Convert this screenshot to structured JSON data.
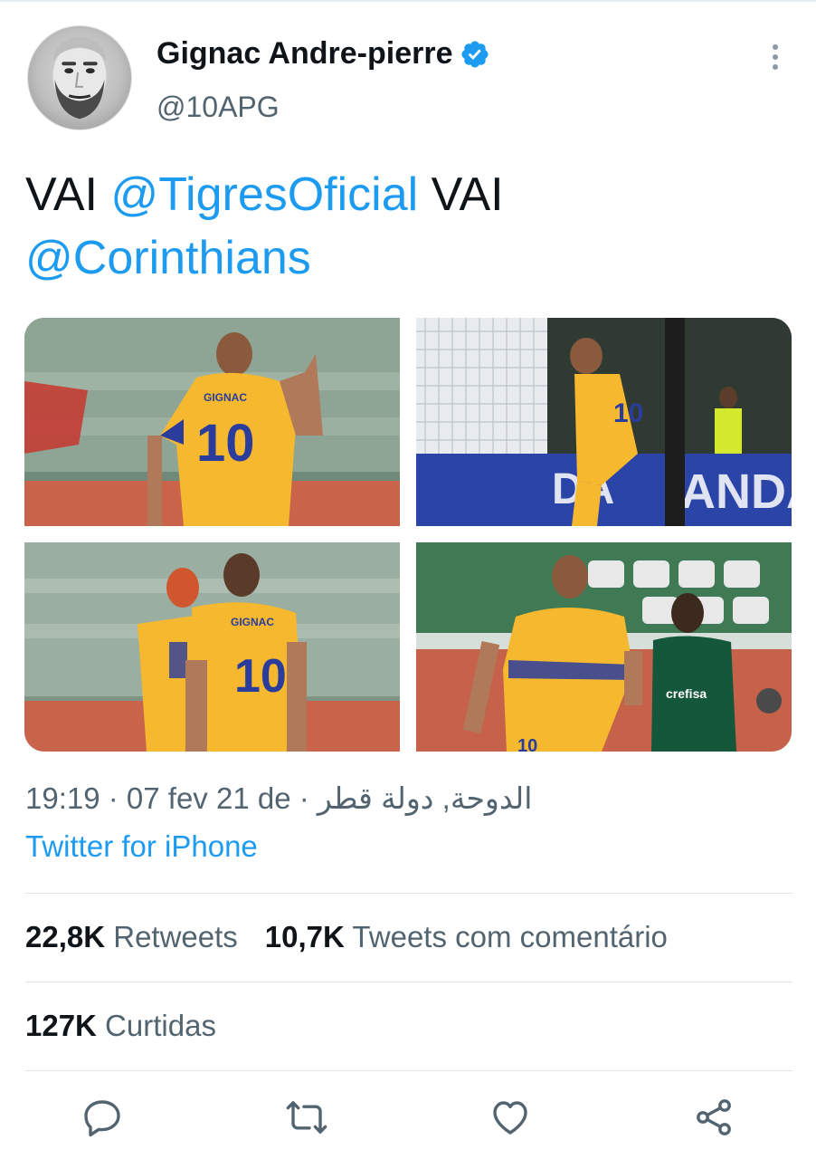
{
  "author": {
    "display_name": "Gignac Andre-pierre",
    "handle": "@10APG",
    "verified": true
  },
  "tweet": {
    "text_part1": "VAI ",
    "mention1": "@TigresOficial",
    "text_part2": " VAI ",
    "mention2": "@Corinthians"
  },
  "media": [
    {
      "name": "photo-1",
      "jersey_text": "GIGNAC",
      "jersey_number": "10"
    },
    {
      "name": "photo-2",
      "jersey_number": "10",
      "board_text": "DA",
      "board_text2": "ANDA"
    },
    {
      "name": "photo-3",
      "jersey_text": "GIGNAC",
      "jersey_number": "10"
    },
    {
      "name": "photo-4",
      "jersey_number": "10",
      "sponsor_text": "crefisa"
    }
  ],
  "meta": {
    "time_date": "19:19 · 07 fev 21 de ",
    "location": "الدوحة, دولة قطر ·",
    "source": "Twitter for iPhone"
  },
  "stats": {
    "retweets_count": "22,8K",
    "retweets_label": " Retweets",
    "quotes_count": "10,7K",
    "quotes_label": " Tweets com comentário",
    "likes_count": "127K",
    "likes_label": " Curtidas"
  },
  "colors": {
    "accent": "#1d9bf0",
    "secondary_text": "#536471",
    "jersey_yellow": "#f5b82e",
    "jersey_blue": "#2a3c9c"
  },
  "icons": [
    "verified-badge-icon",
    "more-options-icon",
    "reply-icon",
    "retweet-icon",
    "like-icon",
    "share-icon"
  ]
}
